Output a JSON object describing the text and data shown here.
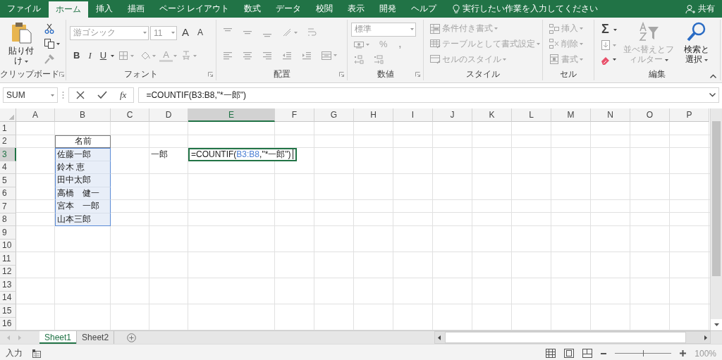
{
  "tabs": [
    {
      "label": "ファイル",
      "selected": false
    },
    {
      "label": "ホーム",
      "selected": true
    },
    {
      "label": "挿入",
      "selected": false
    },
    {
      "label": "描画",
      "selected": false
    },
    {
      "label": "ページ レイアウト",
      "selected": false
    },
    {
      "label": "数式",
      "selected": false
    },
    {
      "label": "データ",
      "selected": false
    },
    {
      "label": "校閲",
      "selected": false
    },
    {
      "label": "表示",
      "selected": false
    },
    {
      "label": "開発",
      "selected": false
    },
    {
      "label": "ヘルプ",
      "selected": false
    }
  ],
  "tell_me": {
    "placeholder": "実行したい作業を入力してください"
  },
  "share": {
    "label": "共有"
  },
  "ribbon": {
    "groups": [
      {
        "label": "クリップボード",
        "launcher": true,
        "sections": [
          {
            "kind": "large",
            "item": {
              "kind": "paste",
              "label": "貼り付け",
              "disabled": false
            }
          },
          {
            "kind": "stack",
            "lines": [
              {
                "items": [
                  {
                    "kind": "cut",
                    "disabled": false
                  }
                ]
              },
              {
                "items": [
                  {
                    "kind": "copy",
                    "disabled": false
                  }
                ]
              },
              {
                "items": [
                  {
                    "kind": "brush",
                    "disabled": true
                  }
                ]
              }
            ]
          }
        ]
      },
      {
        "label": "フォント",
        "launcher": true,
        "sections": [
          {
            "kind": "stack",
            "lines": [
              {
                "items": [
                  {
                    "kind": "font-field",
                    "value": "游ゴシック",
                    "disabled": true
                  },
                  {
                    "kind": "size-field",
                    "value": "11",
                    "disabled": true
                  },
                  {
                    "kind": "grow",
                    "label": "A",
                    "disabled": false
                  },
                  {
                    "kind": "shrink",
                    "label": "A",
                    "disabled": false
                  }
                ]
              },
              {
                "items": [
                  {
                    "kind": "bold",
                    "label": "B",
                    "disabled": false
                  },
                  {
                    "kind": "italic",
                    "label": "I",
                    "disabled": false
                  },
                  {
                    "kind": "underline",
                    "label": "U",
                    "disabled": false
                  },
                  {
                    "kind": "borders",
                    "disabled": true
                  },
                  {
                    "kind": "fill",
                    "disabled": true
                  },
                  {
                    "kind": "font-color",
                    "label": "A",
                    "disabled": true
                  },
                  {
                    "kind": "phonetic",
                    "disabled": true
                  }
                ]
              }
            ]
          }
        ]
      },
      {
        "label": "配置",
        "launcher": true,
        "sections": [
          {
            "kind": "stack",
            "lines": [
              {
                "items": [
                  {
                    "kind": "align-top",
                    "disabled": true
                  },
                  {
                    "kind": "align-middle",
                    "disabled": true
                  },
                  {
                    "kind": "align-bottom",
                    "disabled": true
                  },
                  {
                    "kind": "orientation",
                    "disabled": true
                  },
                  {
                    "kind": "wrap",
                    "disabled": true
                  }
                ]
              },
              {
                "items": [
                  {
                    "kind": "align-left",
                    "disabled": true
                  },
                  {
                    "kind": "align-center",
                    "disabled": true
                  },
                  {
                    "kind": "align-right",
                    "disabled": true
                  },
                  {
                    "kind": "indent-decrease",
                    "disabled": true
                  },
                  {
                    "kind": "indent-increase",
                    "disabled": true
                  },
                  {
                    "kind": "merge",
                    "disabled": true
                  }
                ]
              }
            ]
          }
        ]
      },
      {
        "label": "数値",
        "launcher": true,
        "sections": [
          {
            "kind": "stack",
            "lines": [
              {
                "items": [
                  {
                    "kind": "format-field",
                    "value": "標準",
                    "disabled": true
                  }
                ]
              },
              {
                "items": [
                  {
                    "kind": "currency",
                    "disabled": true
                  },
                  {
                    "kind": "percent",
                    "label": "%",
                    "disabled": true
                  },
                  {
                    "kind": "comma",
                    "label": ",",
                    "disabled": true
                  }
                ]
              },
              {
                "items": [
                  {
                    "kind": "decimal-increase",
                    "disabled": true
                  },
                  {
                    "kind": "decimal-decrease",
                    "disabled": true
                  }
                ]
              }
            ]
          }
        ]
      },
      {
        "label": "スタイル",
        "launcher": false,
        "sections": [
          {
            "kind": "stack",
            "lines": [
              {
                "items": [
                  {
                    "kind": "conditional-format",
                    "label": "条件付き書式",
                    "disabled": true
                  }
                ]
              },
              {
                "items": [
                  {
                    "kind": "table-format",
                    "label": "テーブルとして書式設定",
                    "disabled": true
                  }
                ]
              },
              {
                "items": [
                  {
                    "kind": "cell-style",
                    "label": "セルのスタイル",
                    "disabled": true
                  }
                ]
              }
            ]
          }
        ]
      },
      {
        "label": "セル",
        "launcher": false,
        "sections": [
          {
            "kind": "stack",
            "lines": [
              {
                "items": [
                  {
                    "kind": "insert",
                    "label": "挿入",
                    "disabled": true
                  }
                ]
              },
              {
                "items": [
                  {
                    "kind": "delete",
                    "label": "削除",
                    "disabled": true
                  }
                ]
              },
              {
                "items": [
                  {
                    "kind": "format",
                    "label": "書式",
                    "disabled": true
                  }
                ]
              }
            ]
          }
        ]
      },
      {
        "label": "編集",
        "launcher": false,
        "sections": [
          {
            "kind": "stack",
            "lines": [
              {
                "items": [
                  {
                    "kind": "sum",
                    "label": "Σ",
                    "disabled": false
                  }
                ]
              },
              {
                "items": [
                  {
                    "kind": "fill-down",
                    "disabled": true
                  }
                ]
              },
              {
                "items": [
                  {
                    "kind": "eraser",
                    "disabled": false
                  }
                ]
              }
            ]
          },
          {
            "kind": "large",
            "item": {
              "kind": "sort-filter",
              "label": "並べ替えとフィルター",
              "disabled": true
            }
          },
          {
            "kind": "large",
            "item": {
              "kind": "find",
              "label": "検索と選択",
              "disabled": false
            }
          }
        ]
      }
    ]
  },
  "formula_bar": {
    "name_box": "SUM",
    "function_label": "fx",
    "formula": "=COUNTIF(B3:B8,\"*一郎\")"
  },
  "sheet": {
    "columns": [
      {
        "label": "A",
        "selected": false
      },
      {
        "label": "B",
        "selected": false
      },
      {
        "label": "C",
        "selected": false
      },
      {
        "label": "D",
        "selected": false
      },
      {
        "label": "E",
        "selected": true
      },
      {
        "label": "F",
        "selected": false
      },
      {
        "label": "G",
        "selected": false
      },
      {
        "label": "H",
        "selected": false
      },
      {
        "label": "I",
        "selected": false
      },
      {
        "label": "J",
        "selected": false
      },
      {
        "label": "K",
        "selected": false
      },
      {
        "label": "L",
        "selected": false
      },
      {
        "label": "M",
        "selected": false
      },
      {
        "label": "N",
        "selected": false
      },
      {
        "label": "O",
        "selected": false
      },
      {
        "label": "P",
        "selected": false
      }
    ],
    "rows": [
      {
        "label": "1",
        "selected": false
      },
      {
        "label": "2",
        "selected": false
      },
      {
        "label": "3",
        "selected": true
      },
      {
        "label": "4",
        "selected": false
      },
      {
        "label": "5",
        "selected": false
      },
      {
        "label": "6",
        "selected": false
      },
      {
        "label": "7",
        "selected": false
      },
      {
        "label": "8",
        "selected": false
      },
      {
        "label": "9",
        "selected": false
      },
      {
        "label": "10",
        "selected": false
      },
      {
        "label": "11",
        "selected": false
      },
      {
        "label": "12",
        "selected": false
      },
      {
        "label": "13",
        "selected": false
      },
      {
        "label": "14",
        "selected": false
      },
      {
        "label": "15",
        "selected": false
      },
      {
        "label": "16",
        "selected": false
      }
    ],
    "name_list": {
      "header": "名前",
      "highlighted": true,
      "items": [
        "佐藤一郎",
        "鈴木 恵",
        "田中太郎",
        "高橋　健一",
        "宮本　一郎",
        "山本三郎"
      ]
    },
    "criteria": "一郎",
    "active_cell": {
      "editing": true,
      "parts": [
        {
          "kind": "plain",
          "text": "=COUNTIF("
        },
        {
          "kind": "reference",
          "text": "B3:B8"
        },
        {
          "kind": "plain",
          "text": ",\"*一郎\")"
        }
      ]
    }
  },
  "sheet_tabs": [
    {
      "label": "Sheet1",
      "selected": true
    },
    {
      "label": "Sheet2",
      "selected": false
    }
  ],
  "status_bar": {
    "mode": "入力",
    "zoom": {
      "level": 0.5,
      "reading": "100%"
    }
  }
}
